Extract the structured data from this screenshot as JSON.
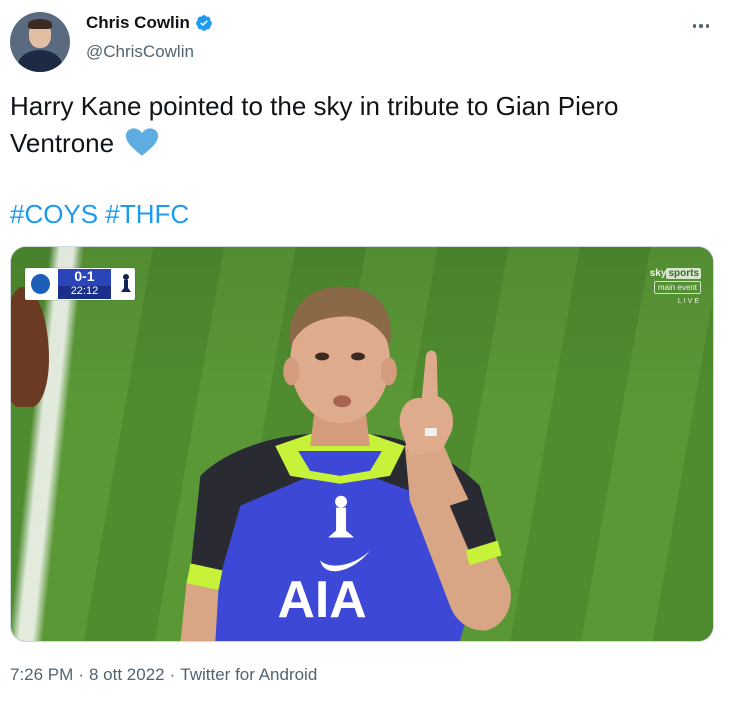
{
  "author": {
    "display_name": "Chris Cowlin",
    "handle": "@ChrisCowlin",
    "verified": true,
    "avatar_icon": "profile-photo"
  },
  "tweet": {
    "text": "Harry Kane pointed to the sky in tribute to Gian Piero Ventrone",
    "emoji_icon": "blue-heart-icon",
    "hashtags": [
      "#COYS",
      "#THFC"
    ]
  },
  "media": {
    "scorebug": {
      "score": "0-1",
      "clock": "22:12"
    },
    "broadcaster": {
      "line1_a": "sky",
      "line1_b": "sports",
      "line2": "main event",
      "line3": "LIVE"
    },
    "shirt_sponsor": "AIA"
  },
  "meta": {
    "time": "7:26 PM",
    "separator": "·",
    "date": "8 ott 2022",
    "source": "Twitter for Android"
  },
  "colors": {
    "link": "#1d9bf0",
    "secondary_text": "#536471",
    "primary_text": "#0f1419",
    "verified": "#1d9bf0",
    "heart": "#5dade2"
  }
}
